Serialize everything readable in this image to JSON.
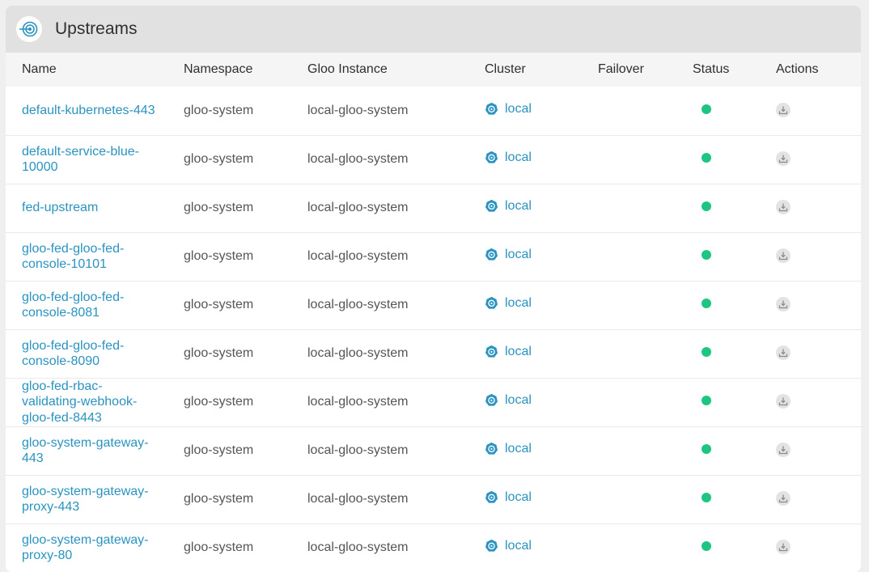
{
  "panel": {
    "title": "Upstreams",
    "icon": "upstream-icon"
  },
  "table": {
    "headers": {
      "name": "Name",
      "namespace": "Namespace",
      "instance": "Gloo Instance",
      "cluster": "Cluster",
      "failover": "Failover",
      "status": "Status",
      "actions": "Actions"
    },
    "rows": [
      {
        "name": "default-kubernetes-443",
        "namespace": "gloo-system",
        "instance": "local-gloo-system",
        "cluster": "local",
        "failover": "",
        "status": "accepted"
      },
      {
        "name": "default-service-blue-10000",
        "namespace": "gloo-system",
        "instance": "local-gloo-system",
        "cluster": "local",
        "failover": "",
        "status": "accepted"
      },
      {
        "name": "fed-upstream",
        "namespace": "gloo-system",
        "instance": "local-gloo-system",
        "cluster": "local",
        "failover": "",
        "status": "accepted"
      },
      {
        "name": "gloo-fed-gloo-fed-console-10101",
        "namespace": "gloo-system",
        "instance": "local-gloo-system",
        "cluster": "local",
        "failover": "",
        "status": "accepted"
      },
      {
        "name": "gloo-fed-gloo-fed-console-8081",
        "namespace": "gloo-system",
        "instance": "local-gloo-system",
        "cluster": "local",
        "failover": "",
        "status": "accepted"
      },
      {
        "name": "gloo-fed-gloo-fed-console-8090",
        "namespace": "gloo-system",
        "instance": "local-gloo-system",
        "cluster": "local",
        "failover": "",
        "status": "accepted"
      },
      {
        "name": "gloo-fed-rbac-validating-webhook-gloo-fed-8443",
        "namespace": "gloo-system",
        "instance": "local-gloo-system",
        "cluster": "local",
        "failover": "",
        "status": "accepted"
      },
      {
        "name": "gloo-system-gateway-443",
        "namespace": "gloo-system",
        "instance": "local-gloo-system",
        "cluster": "local",
        "failover": "",
        "status": "accepted"
      },
      {
        "name": "gloo-system-gateway-proxy-443",
        "namespace": "gloo-system",
        "instance": "local-gloo-system",
        "cluster": "local",
        "failover": "",
        "status": "accepted"
      },
      {
        "name": "gloo-system-gateway-proxy-80",
        "namespace": "gloo-system",
        "instance": "local-gloo-system",
        "cluster": "local",
        "failover": "",
        "status": "accepted"
      }
    ]
  },
  "colors": {
    "link": "#2a93c0",
    "status_ok": "#1ec580"
  },
  "icons": {
    "cluster": "kubernetes-icon",
    "status": "status-dot",
    "action": "download-icon"
  }
}
